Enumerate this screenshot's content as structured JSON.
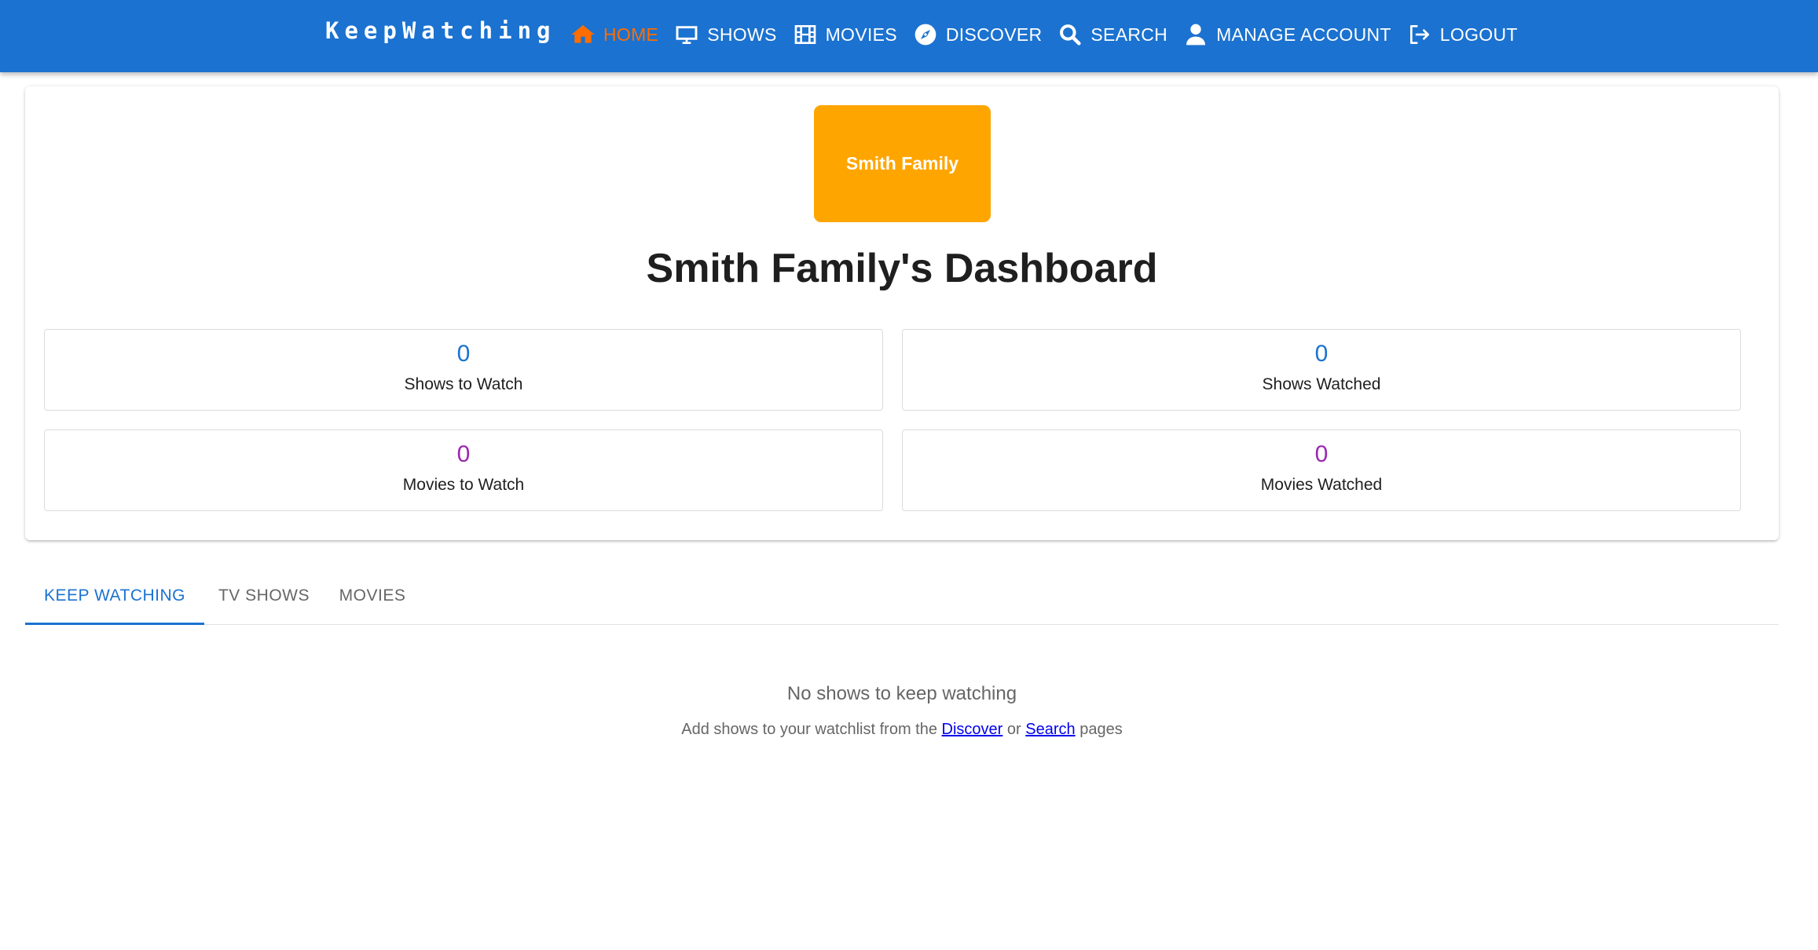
{
  "app": {
    "brand": "KeepWatching"
  },
  "nav": {
    "items": [
      {
        "label": "HOME",
        "icon": "home-icon",
        "active": true
      },
      {
        "label": "SHOWS",
        "icon": "tv-icon"
      },
      {
        "label": "MOVIES",
        "icon": "film-icon"
      },
      {
        "label": "DISCOVER",
        "icon": "compass-icon"
      },
      {
        "label": "SEARCH",
        "icon": "search-icon"
      },
      {
        "label": "MANAGE ACCOUNT",
        "icon": "person-icon"
      },
      {
        "label": "LOGOUT",
        "icon": "logout-icon"
      }
    ]
  },
  "profile": {
    "name": "Smith Family",
    "avatar_color": "#ffa500"
  },
  "dashboard": {
    "title": "Smith Family's Dashboard",
    "stats": [
      {
        "value": "0",
        "label": "Shows to Watch",
        "color": "#1b72d0"
      },
      {
        "value": "0",
        "label": "Shows Watched",
        "color": "#1b72d0"
      },
      {
        "value": "0",
        "label": "Movies to Watch",
        "color": "#9c27b0"
      },
      {
        "value": "0",
        "label": "Movies Watched",
        "color": "#9c27b0"
      }
    ]
  },
  "tabs": [
    {
      "label": "KEEP WATCHING",
      "active": true
    },
    {
      "label": "TV SHOWS"
    },
    {
      "label": "MOVIES"
    }
  ],
  "empty_state": {
    "title": "No shows to keep watching",
    "prefix": "Add shows to your watchlist from the",
    "link1": "Discover",
    "middle": "or",
    "link2": "Search",
    "suffix": "pages"
  },
  "colors": {
    "appbar": "#1b72d0",
    "active_nav": "#ff6d00",
    "link": "#0000ee"
  }
}
